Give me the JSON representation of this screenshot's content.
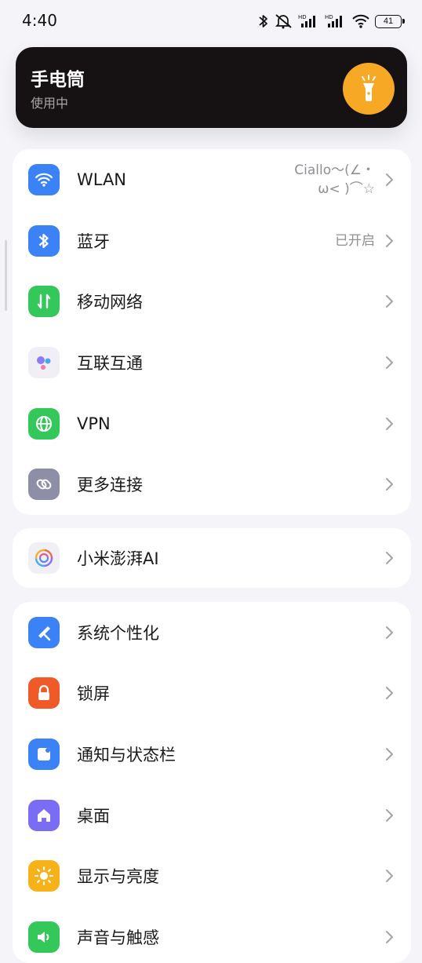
{
  "status_bar": {
    "time": "4:40",
    "battery": "41",
    "icons": [
      "bluetooth-icon",
      "mute-icon",
      "hd-signal-icon",
      "hd-signal-icon",
      "wifi-icon",
      "battery-icon"
    ]
  },
  "flashlight": {
    "title": "手电筒",
    "subtitle": "使用中",
    "accent": "#f7a825",
    "icon": "flashlight-icon"
  },
  "group1": [
    {
      "label": "WLAN",
      "value": "Ciallo～(∠・ω< )⌒☆",
      "icon": "wifi-icon",
      "color": "#3b82f6"
    },
    {
      "label": "蓝牙",
      "value": "已开启",
      "icon": "bluetooth-icon",
      "color": "#3b82f6"
    },
    {
      "label": "移动网络",
      "value": "",
      "icon": "mobile-data-icon",
      "color": "#34c759"
    },
    {
      "label": "互联互通",
      "value": "",
      "icon": "interconnect-icon",
      "color": "#f0eff5"
    },
    {
      "label": "VPN",
      "value": "",
      "icon": "globe-icon",
      "color": "#34c759"
    },
    {
      "label": "更多连接",
      "value": "",
      "icon": "link-icon",
      "color": "#8e8fa6"
    }
  ],
  "group2": [
    {
      "label": "小米澎湃AI",
      "value": "",
      "icon": "hyperos-ai-icon",
      "color": "#f0eff5"
    }
  ],
  "group3": [
    {
      "label": "系统个性化",
      "value": "",
      "icon": "paint-brush-icon",
      "color": "#3b82f6"
    },
    {
      "label": "锁屏",
      "value": "",
      "icon": "lock-icon",
      "color": "#f05a28"
    },
    {
      "label": "通知与状态栏",
      "value": "",
      "icon": "notification-icon",
      "color": "#3b82f6"
    },
    {
      "label": "桌面",
      "value": "",
      "icon": "home-icon",
      "color": "#7b6cf6"
    },
    {
      "label": "显示与亮度",
      "value": "",
      "icon": "sun-icon",
      "color": "#f7b21a"
    },
    {
      "label": "声音与触感",
      "value": "",
      "icon": "speaker-icon",
      "color": "#34c759"
    }
  ]
}
